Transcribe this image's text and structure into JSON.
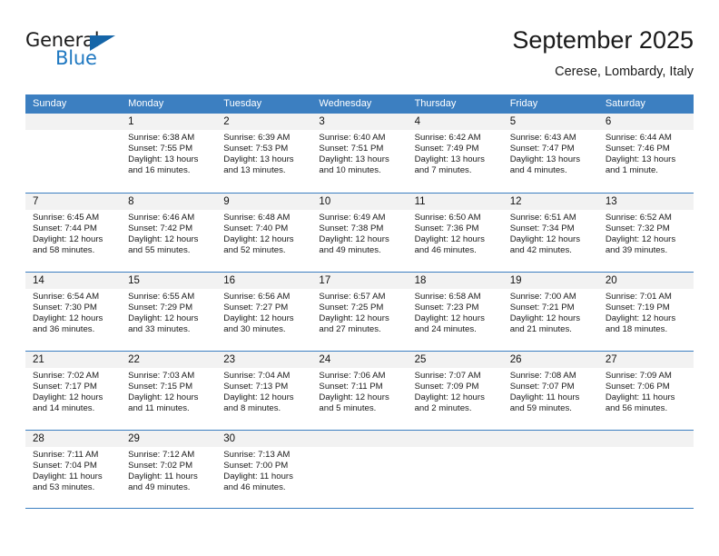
{
  "logo": {
    "word1": "General",
    "word2": "Blue",
    "triangle_color": "#1565a8",
    "blue_color": "#1f78c1",
    "icon": "triangle-logo-icon"
  },
  "header": {
    "title": "September 2025",
    "location": "Cerese, Lombardy, Italy"
  },
  "calendar": {
    "header_bg": "#3c7fc1",
    "daynum_bg": "#f2f2f2",
    "weekdays": [
      "Sunday",
      "Monday",
      "Tuesday",
      "Wednesday",
      "Thursday",
      "Friday",
      "Saturday"
    ],
    "labels": {
      "sunrise": "Sunrise:",
      "sunset": "Sunset:",
      "daylight": "Daylight:"
    },
    "weeks": [
      [
        {
          "day": "",
          "sunrise": "",
          "sunset": "",
          "daylight_line1": "",
          "daylight_line2": ""
        },
        {
          "day": "1",
          "sunrise": "Sunrise: 6:38 AM",
          "sunset": "Sunset: 7:55 PM",
          "daylight_line1": "Daylight: 13 hours",
          "daylight_line2": "and 16 minutes."
        },
        {
          "day": "2",
          "sunrise": "Sunrise: 6:39 AM",
          "sunset": "Sunset: 7:53 PM",
          "daylight_line1": "Daylight: 13 hours",
          "daylight_line2": "and 13 minutes."
        },
        {
          "day": "3",
          "sunrise": "Sunrise: 6:40 AM",
          "sunset": "Sunset: 7:51 PM",
          "daylight_line1": "Daylight: 13 hours",
          "daylight_line2": "and 10 minutes."
        },
        {
          "day": "4",
          "sunrise": "Sunrise: 6:42 AM",
          "sunset": "Sunset: 7:49 PM",
          "daylight_line1": "Daylight: 13 hours",
          "daylight_line2": "and 7 minutes."
        },
        {
          "day": "5",
          "sunrise": "Sunrise: 6:43 AM",
          "sunset": "Sunset: 7:47 PM",
          "daylight_line1": "Daylight: 13 hours",
          "daylight_line2": "and 4 minutes."
        },
        {
          "day": "6",
          "sunrise": "Sunrise: 6:44 AM",
          "sunset": "Sunset: 7:46 PM",
          "daylight_line1": "Daylight: 13 hours",
          "daylight_line2": "and 1 minute."
        }
      ],
      [
        {
          "day": "7",
          "sunrise": "Sunrise: 6:45 AM",
          "sunset": "Sunset: 7:44 PM",
          "daylight_line1": "Daylight: 12 hours",
          "daylight_line2": "and 58 minutes."
        },
        {
          "day": "8",
          "sunrise": "Sunrise: 6:46 AM",
          "sunset": "Sunset: 7:42 PM",
          "daylight_line1": "Daylight: 12 hours",
          "daylight_line2": "and 55 minutes."
        },
        {
          "day": "9",
          "sunrise": "Sunrise: 6:48 AM",
          "sunset": "Sunset: 7:40 PM",
          "daylight_line1": "Daylight: 12 hours",
          "daylight_line2": "and 52 minutes."
        },
        {
          "day": "10",
          "sunrise": "Sunrise: 6:49 AM",
          "sunset": "Sunset: 7:38 PM",
          "daylight_line1": "Daylight: 12 hours",
          "daylight_line2": "and 49 minutes."
        },
        {
          "day": "11",
          "sunrise": "Sunrise: 6:50 AM",
          "sunset": "Sunset: 7:36 PM",
          "daylight_line1": "Daylight: 12 hours",
          "daylight_line2": "and 46 minutes."
        },
        {
          "day": "12",
          "sunrise": "Sunrise: 6:51 AM",
          "sunset": "Sunset: 7:34 PM",
          "daylight_line1": "Daylight: 12 hours",
          "daylight_line2": "and 42 minutes."
        },
        {
          "day": "13",
          "sunrise": "Sunrise: 6:52 AM",
          "sunset": "Sunset: 7:32 PM",
          "daylight_line1": "Daylight: 12 hours",
          "daylight_line2": "and 39 minutes."
        }
      ],
      [
        {
          "day": "14",
          "sunrise": "Sunrise: 6:54 AM",
          "sunset": "Sunset: 7:30 PM",
          "daylight_line1": "Daylight: 12 hours",
          "daylight_line2": "and 36 minutes."
        },
        {
          "day": "15",
          "sunrise": "Sunrise: 6:55 AM",
          "sunset": "Sunset: 7:29 PM",
          "daylight_line1": "Daylight: 12 hours",
          "daylight_line2": "and 33 minutes."
        },
        {
          "day": "16",
          "sunrise": "Sunrise: 6:56 AM",
          "sunset": "Sunset: 7:27 PM",
          "daylight_line1": "Daylight: 12 hours",
          "daylight_line2": "and 30 minutes."
        },
        {
          "day": "17",
          "sunrise": "Sunrise: 6:57 AM",
          "sunset": "Sunset: 7:25 PM",
          "daylight_line1": "Daylight: 12 hours",
          "daylight_line2": "and 27 minutes."
        },
        {
          "day": "18",
          "sunrise": "Sunrise: 6:58 AM",
          "sunset": "Sunset: 7:23 PM",
          "daylight_line1": "Daylight: 12 hours",
          "daylight_line2": "and 24 minutes."
        },
        {
          "day": "19",
          "sunrise": "Sunrise: 7:00 AM",
          "sunset": "Sunset: 7:21 PM",
          "daylight_line1": "Daylight: 12 hours",
          "daylight_line2": "and 21 minutes."
        },
        {
          "day": "20",
          "sunrise": "Sunrise: 7:01 AM",
          "sunset": "Sunset: 7:19 PM",
          "daylight_line1": "Daylight: 12 hours",
          "daylight_line2": "and 18 minutes."
        }
      ],
      [
        {
          "day": "21",
          "sunrise": "Sunrise: 7:02 AM",
          "sunset": "Sunset: 7:17 PM",
          "daylight_line1": "Daylight: 12 hours",
          "daylight_line2": "and 14 minutes."
        },
        {
          "day": "22",
          "sunrise": "Sunrise: 7:03 AM",
          "sunset": "Sunset: 7:15 PM",
          "daylight_line1": "Daylight: 12 hours",
          "daylight_line2": "and 11 minutes."
        },
        {
          "day": "23",
          "sunrise": "Sunrise: 7:04 AM",
          "sunset": "Sunset: 7:13 PM",
          "daylight_line1": "Daylight: 12 hours",
          "daylight_line2": "and 8 minutes."
        },
        {
          "day": "24",
          "sunrise": "Sunrise: 7:06 AM",
          "sunset": "Sunset: 7:11 PM",
          "daylight_line1": "Daylight: 12 hours",
          "daylight_line2": "and 5 minutes."
        },
        {
          "day": "25",
          "sunrise": "Sunrise: 7:07 AM",
          "sunset": "Sunset: 7:09 PM",
          "daylight_line1": "Daylight: 12 hours",
          "daylight_line2": "and 2 minutes."
        },
        {
          "day": "26",
          "sunrise": "Sunrise: 7:08 AM",
          "sunset": "Sunset: 7:07 PM",
          "daylight_line1": "Daylight: 11 hours",
          "daylight_line2": "and 59 minutes."
        },
        {
          "day": "27",
          "sunrise": "Sunrise: 7:09 AM",
          "sunset": "Sunset: 7:06 PM",
          "daylight_line1": "Daylight: 11 hours",
          "daylight_line2": "and 56 minutes."
        }
      ],
      [
        {
          "day": "28",
          "sunrise": "Sunrise: 7:11 AM",
          "sunset": "Sunset: 7:04 PM",
          "daylight_line1": "Daylight: 11 hours",
          "daylight_line2": "and 53 minutes."
        },
        {
          "day": "29",
          "sunrise": "Sunrise: 7:12 AM",
          "sunset": "Sunset: 7:02 PM",
          "daylight_line1": "Daylight: 11 hours",
          "daylight_line2": "and 49 minutes."
        },
        {
          "day": "30",
          "sunrise": "Sunrise: 7:13 AM",
          "sunset": "Sunset: 7:00 PM",
          "daylight_line1": "Daylight: 11 hours",
          "daylight_line2": "and 46 minutes."
        },
        {
          "day": "",
          "sunrise": "",
          "sunset": "",
          "daylight_line1": "",
          "daylight_line2": ""
        },
        {
          "day": "",
          "sunrise": "",
          "sunset": "",
          "daylight_line1": "",
          "daylight_line2": ""
        },
        {
          "day": "",
          "sunrise": "",
          "sunset": "",
          "daylight_line1": "",
          "daylight_line2": ""
        },
        {
          "day": "",
          "sunrise": "",
          "sunset": "",
          "daylight_line1": "",
          "daylight_line2": ""
        }
      ]
    ]
  }
}
